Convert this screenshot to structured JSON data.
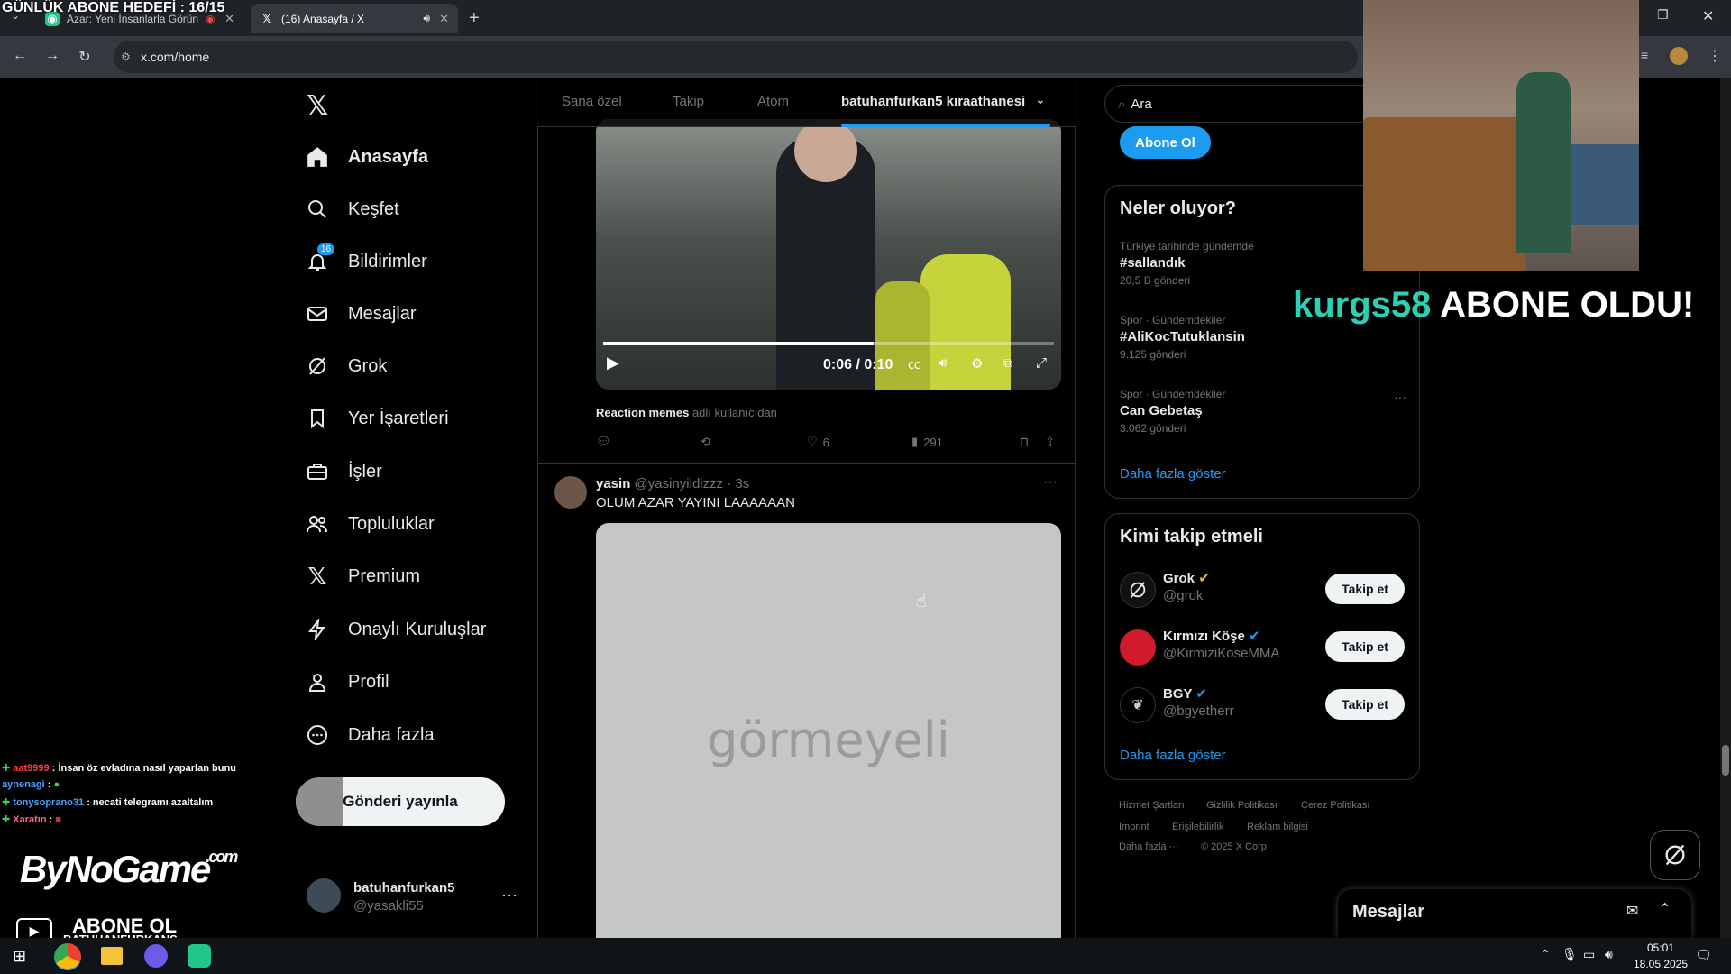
{
  "overlay": {
    "goal_text": "GÜNLÜK ABONE HEDEFİ : 16/15",
    "subscriber_name": "kurgs58",
    "subscriber_text": "ABONE OLDU!",
    "brand_logo": "ByNoGame",
    "brand_logo_suffix": ".com",
    "subscribe_label": "ABONE OL",
    "subscribe_channel": "BATUHANFURKANS"
  },
  "chat": [
    {
      "user": "aat9999",
      "text": ": İnsan öz evladına nasıl yaparlan bunu",
      "user_color": "#ff3b3b"
    },
    {
      "user": "aynenagi",
      "text": ":",
      "user_color": "#4aa3ff"
    },
    {
      "user": "tonysoprano31",
      "text": ": necati telegramı azaltalım",
      "user_color": "#4aa3ff"
    },
    {
      "user": "Xaratın",
      "text": ":",
      "user_color": "#ff5fa2"
    }
  ],
  "browser": {
    "tabs": [
      {
        "title": "Azar: Yeni İnsanlarla Görün",
        "icon": "azar-icon"
      },
      {
        "title": "(16) Anasayfa / X",
        "icon": "x-logo-icon"
      }
    ],
    "url": "x.com/home"
  },
  "nav": {
    "items": [
      {
        "label": "Anasayfa",
        "icon": "home-icon"
      },
      {
        "label": "Keşfet",
        "icon": "search-icon"
      },
      {
        "label": "Bildirimler",
        "icon": "bell-icon",
        "badge": "16"
      },
      {
        "label": "Mesajlar",
        "icon": "mail-icon"
      },
      {
        "label": "Grok",
        "icon": "grok-icon"
      },
      {
        "label": "Yer İşaretleri",
        "icon": "bookmark-icon"
      },
      {
        "label": "İşler",
        "icon": "briefcase-icon"
      },
      {
        "label": "Topluluklar",
        "icon": "people-icon"
      },
      {
        "label": "Premium",
        "icon": "x-logo-icon"
      },
      {
        "label": "Onaylı Kuruluşlar",
        "icon": "lightning-icon"
      },
      {
        "label": "Profil",
        "icon": "person-icon"
      },
      {
        "label": "Daha fazla",
        "icon": "more-circle-icon"
      }
    ],
    "post_button": "Gönderi yayınla",
    "account": {
      "name": "batuhanfurkan5",
      "handle": "@yasakli55"
    }
  },
  "feed": {
    "tabs": [
      "Sana özel",
      "Takip",
      "Atom",
      "batuhanfurkan5 kıraathanesi"
    ],
    "post1": {
      "video_time": "0:06 / 0:10",
      "video_progress": 0.6,
      "caption_bold": "Reaction memes",
      "caption_rest": "adlı kullanıcıdan",
      "likes": "6",
      "views": "291"
    },
    "post2": {
      "name": "yasin",
      "handle": "@yasinyildizzz",
      "time": "· 3s",
      "text": "OLUM AZAR YAYINI LAAAAAAN",
      "image_text": "görmeyeli"
    }
  },
  "right": {
    "search_placeholder": "Ara",
    "subscribe_button": "Abone Ol",
    "trends_title": "Neler oluyor?",
    "trends": [
      {
        "context": "Türkiye tarihinde gündemde",
        "title": "#sallandık",
        "count": "20,5 B gönderi"
      },
      {
        "context": "Spor · Gündemdekiler",
        "title": "#AliKocTutuklansin",
        "count": "9.125 gönderi"
      },
      {
        "context": "Spor · Gündemdekiler",
        "title": "Can Gebetaş",
        "count": "3.062 gönderi"
      }
    ],
    "show_more": "Daha fazla göster",
    "who_title": "Kimi takip etmeli",
    "who": [
      {
        "name": "Grok",
        "handle": "@grok",
        "button": "Takip et"
      },
      {
        "name": "Kırmızı Köşe",
        "handle": "@KirmiziKoseMMA",
        "button": "Takip et"
      },
      {
        "name": "BGY",
        "handle": "@bgyetherr",
        "button": "Takip et"
      }
    ],
    "who_show_more": "Daha fazla göster",
    "footer": [
      "Hizmet Şartları",
      "Gizlilik Politikası",
      "Çerez Politikası",
      "Imprint",
      "Erişilebilirlik",
      "Reklam bilgisi",
      "Daha fazla ···",
      "© 2025 X Corp."
    ],
    "messages_title": "Mesajlar"
  },
  "taskbar": {
    "time": "05:01",
    "date": "18.05.2025"
  },
  "colors": {
    "accent": "#1d9bf0",
    "subscriber_name": "#2bd1b5"
  }
}
